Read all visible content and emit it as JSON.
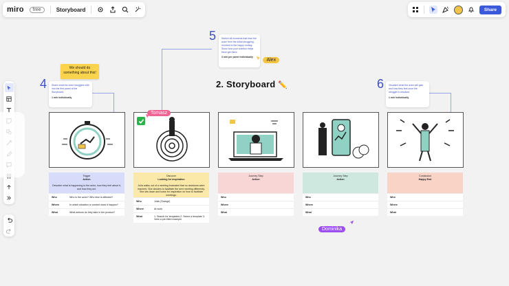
{
  "topbar": {
    "logo": "miro",
    "plan": "free",
    "board_title": "Storyboard",
    "share_label": "Share"
  },
  "board": {
    "title": "2. Storyboard",
    "title_emoji": "✏️"
  },
  "steps": [
    {
      "number": "4",
      "text": "Share what the actor struggles with into the first panel of the Storyboard.",
      "meta": "1 min individually"
    },
    {
      "number": "5",
      "text": "Sketch all moments that lead the actor from the initial struggling moment to the happy ending. Show how your solution helps them get there.",
      "meta": "3 min per panel individually"
    },
    {
      "number": "6",
      "text": "Visualize what the actor will gain and how they feel once the struggle is resolved.",
      "meta": "1 min individually"
    }
  ],
  "sticky": {
    "text": "We should do something about this!"
  },
  "cursors": {
    "alex": "Alex",
    "tomasz": "Tomasz",
    "dominika": "Dominika"
  },
  "cards": [
    {
      "header_line1": "Trigger",
      "header_line2": "Action",
      "description": "Describe what is happening to the actor, how they feel about it, and how they act.",
      "rows": [
        {
          "k": "Who",
          "v": "Who is the actor? Who else is affected?"
        },
        {
          "k": "Where",
          "v": "In which situation or context does it happen?"
        },
        {
          "k": "What",
          "v": "What actions do they take in the product?"
        }
      ]
    },
    {
      "header_line1": "Discover",
      "header_line2": "Looking for inspiration",
      "description": "Julia walks out of a meeting frustrated that no decisions were reached. She decides to facilitate the next meeting differently. She sits down and looks for inspiration on how to facilitate meetings.",
      "rows": [
        {
          "k": "Who",
          "v": "Julia (Change)"
        },
        {
          "k": "Where",
          "v": "At work"
        },
        {
          "k": "What",
          "v": "1. Search for templates  2. Select a template  3. View a pre-filled example"
        }
      ]
    },
    {
      "header_line1": "Journey Step",
      "header_line2": "Action",
      "description": "",
      "rows": [
        {
          "k": "Who",
          "v": ""
        },
        {
          "k": "Where",
          "v": ""
        },
        {
          "k": "What",
          "v": ""
        }
      ]
    },
    {
      "header_line1": "Journey Step",
      "header_line2": "Action",
      "description": "",
      "rows": [
        {
          "k": "Who",
          "v": ""
        },
        {
          "k": "Where",
          "v": ""
        },
        {
          "k": "What",
          "v": ""
        }
      ]
    },
    {
      "header_line1": "Conclusion",
      "header_line2": "Happy End",
      "description": "",
      "rows": [
        {
          "k": "Who",
          "v": ""
        },
        {
          "k": "Where",
          "v": ""
        },
        {
          "k": "What",
          "v": ""
        }
      ]
    }
  ],
  "colors": {
    "accent": "#3a5ad9",
    "card_blue": "#d8dcfb",
    "card_yellow": "#fbe9a9",
    "card_pink": "#f9d6d6",
    "card_green": "#cfe8df",
    "card_salmon": "#f8d3c6",
    "cursor_tomasz": "#f06292",
    "cursor_alex": "#f5c542",
    "cursor_dominika": "#9b4ff0"
  }
}
